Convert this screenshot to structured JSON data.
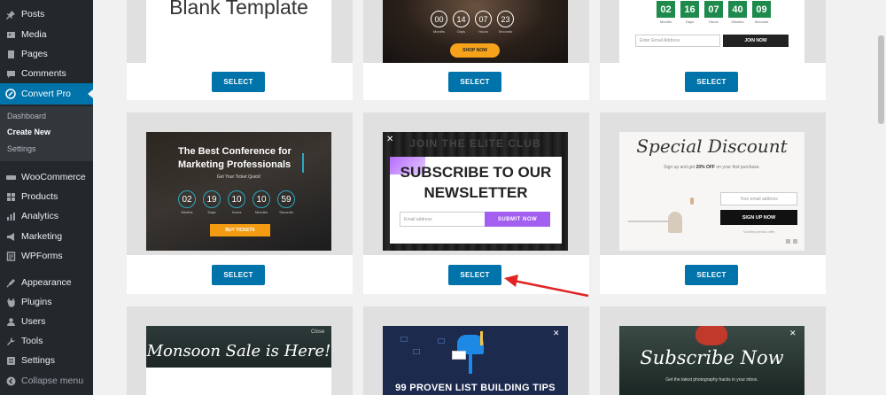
{
  "sidebar": {
    "items": [
      {
        "label": "Posts",
        "icon": "pushpin-icon"
      },
      {
        "label": "Media",
        "icon": "media-icon"
      },
      {
        "label": "Pages",
        "icon": "pages-icon"
      },
      {
        "label": "Comments",
        "icon": "comments-icon"
      },
      {
        "label": "Convert Pro",
        "icon": "convert-pro-icon"
      },
      {
        "label": "WooCommerce",
        "icon": "woocommerce-icon"
      },
      {
        "label": "Products",
        "icon": "products-icon"
      },
      {
        "label": "Analytics",
        "icon": "analytics-icon"
      },
      {
        "label": "Marketing",
        "icon": "marketing-icon"
      },
      {
        "label": "WPForms",
        "icon": "wpforms-icon"
      },
      {
        "label": "Appearance",
        "icon": "appearance-icon"
      },
      {
        "label": "Plugins",
        "icon": "plugins-icon"
      },
      {
        "label": "Users",
        "icon": "users-icon"
      },
      {
        "label": "Tools",
        "icon": "tools-icon"
      },
      {
        "label": "Settings",
        "icon": "settings-icon"
      }
    ],
    "submenu": [
      "Dashboard",
      "Create New",
      "Settings"
    ],
    "collapse_label": "Collapse menu"
  },
  "templates": {
    "select_label": "SELECT",
    "blank": {
      "title": "Blank Template"
    },
    "shop": {
      "digits": [
        "00",
        "14",
        "07",
        "23"
      ],
      "labels": [
        "Months",
        "Days",
        "Hours",
        "Seconds"
      ],
      "button": "SHOP NOW"
    },
    "green_countdown": {
      "digits": [
        "02",
        "16",
        "07",
        "40",
        "09"
      ],
      "labels": [
        "Months",
        "Days",
        "Hours",
        "Minutes",
        "Seconds"
      ],
      "email_placeholder": "Enter Email Address",
      "button": "JOIN NOW"
    },
    "conference": {
      "title_line1": "The Best Conference for",
      "title_line2": "Marketing Professionals",
      "subtitle": "Get Your Ticket Quick!",
      "digits": [
        "02",
        "19",
        "10",
        "10",
        "59"
      ],
      "labels": [
        "Months",
        "Days",
        "Hours",
        "Minutes",
        "Seconds"
      ],
      "button": "BUY TICKETS"
    },
    "newsletter": {
      "bg_text": "JOIN THE ELITE CLUB",
      "title_line1": "SUBSCRIBE TO OUR",
      "title_line2": "NEWSLETTER",
      "email_placeholder": "Email address",
      "button": "SUBMIT NOW"
    },
    "special_discount": {
      "title": "Special Discount",
      "subtitle_pre": "Sign up and get ",
      "subtitle_bold": "20% OFF",
      "subtitle_post": " on your first purchase.",
      "email_placeholder": "Your email address",
      "button": "SIGN UP NOW",
      "note": "*Limited period offer"
    },
    "monsoon": {
      "title": "Monsoon Sale is Here!",
      "close": "Close"
    },
    "list_building": {
      "title": "99 PROVEN LIST BUILDING TIPS"
    },
    "subscribe_now": {
      "title": "Subscribe Now",
      "subtitle": "Get the latest photography hacks in your inbox."
    }
  },
  "colors": {
    "sidebar_bg": "#23282d",
    "accent": "#0073aa",
    "annotation_arrow": "#e02424",
    "countdown_green": "#1e8a4c",
    "newsletter_purple": "#a25ff0"
  }
}
